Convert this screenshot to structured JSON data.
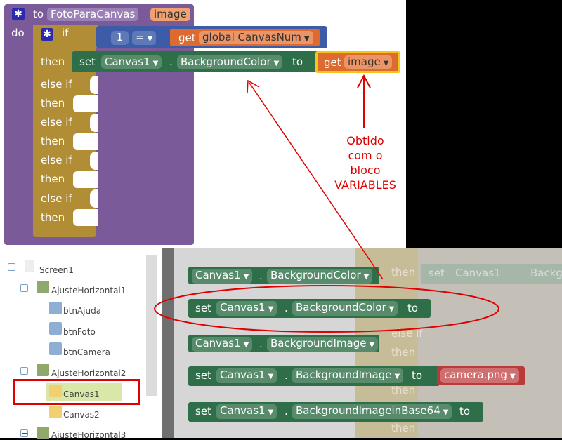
{
  "proc": {
    "to": "to",
    "name": "FotoParaCanvas",
    "param": "image",
    "do": "do"
  },
  "if_block": {
    "if": "if",
    "then": "then",
    "elseif": "else if",
    "num": "1",
    "op": "=",
    "get": "get",
    "var": "global CanvasNum"
  },
  "set_block": {
    "set": "set",
    "comp": "Canvas1",
    "dot": ".",
    "prop": "BackgroundColor",
    "to": "to",
    "get": "get",
    "var": "image"
  },
  "annotation": {
    "line1": "Obtido",
    "line2": "com o",
    "line3": "bloco",
    "line4": "VARIABLES"
  },
  "tree": {
    "screen": "Screen1",
    "ah1": "AjusteHorizontal1",
    "btn1": "btnAjuda",
    "btn2": "btnFoto",
    "btn3": "btnCamera",
    "ah2": "AjusteHorizontal2",
    "c1": "Canvas1",
    "c2": "Canvas2",
    "ah3": "AjusteHorizontal3"
  },
  "drawer": {
    "b1_comp": "Canvas1",
    "b1_prop": "BackgroundColor",
    "b2_set": "set",
    "b2_comp": "Canvas1",
    "b2_prop": "BackgroundColor",
    "b2_to": "to",
    "b3_comp": "Canvas1",
    "b3_prop": "BackgroundImage",
    "b4_set": "set",
    "b4_comp": "Canvas1",
    "b4_prop": "BackgroundImage",
    "b4_to": "to",
    "b4_text": "camera.png",
    "b5_set": "set",
    "b5_comp": "Canvas1",
    "b5_prop": "BackgroundImageinBase64",
    "b5_to": "to",
    "dot": "."
  },
  "bg_ghost": {
    "then": "then",
    "else_if": "else if",
    "set": "set",
    "canvas": "Canvas1",
    "backg": "Backg"
  },
  "colors": {
    "procedure": "#7a5a98",
    "control": "#b18e35",
    "math": "#3c5ca8",
    "variable": "#dd6a2e",
    "component": "#2e6e48",
    "text": "#b83a3a",
    "annotation": "#e00000"
  }
}
